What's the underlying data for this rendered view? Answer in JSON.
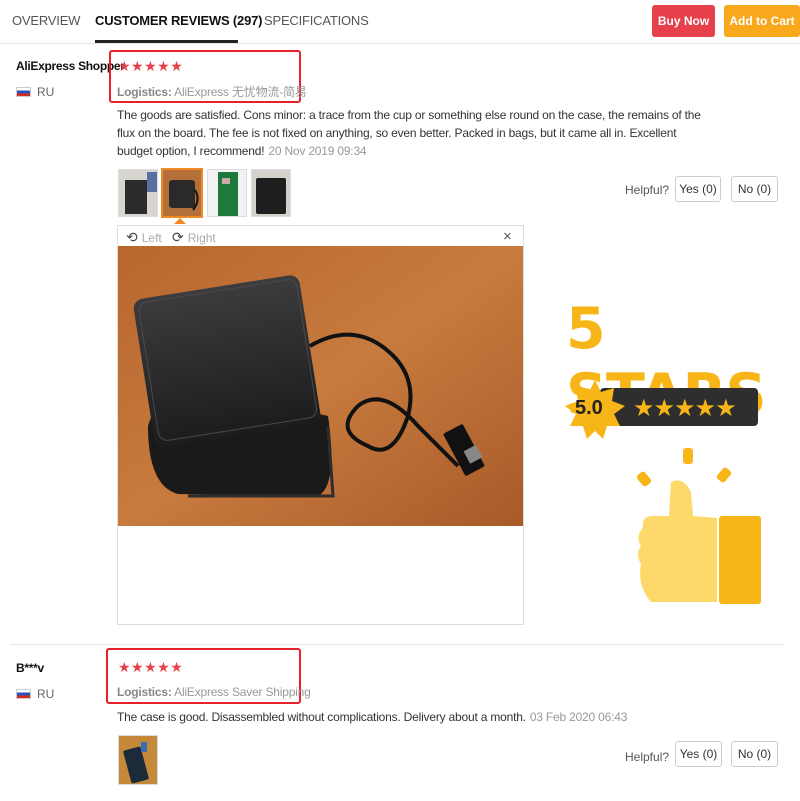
{
  "tabs": [
    {
      "label": "OVERVIEW",
      "active": false
    },
    {
      "label": "CUSTOMER REVIEWS (297)",
      "active": true
    },
    {
      "label": "SPECIFICATIONS",
      "active": false
    }
  ],
  "actions": {
    "buy_now": "Buy Now",
    "add_to_cart": "Add to Cart"
  },
  "reviews": [
    {
      "name": "AliExpress Shopper",
      "country": "RU",
      "stars": "★★★★★",
      "rating": 5,
      "logistics_label": "Logistics:",
      "logistics_value": "AliExpress 无忧物流-简易",
      "text": "The goods are satisfied. Cons minor: a trace from the cup or something else round on the case, the remains of the flux on the board. The fee is not fixed on anything, so even better. Packed in bags, but it came all in. Excellent budget option, I recommend!",
      "date": "20 Nov 2019 09:34",
      "helpful_label": "Helpful?",
      "yes_label": "Yes (0)",
      "no_label": "No (0)"
    },
    {
      "name": "B***v",
      "country": "RU",
      "stars": "★★★★★",
      "rating": 5,
      "logistics_label": "Logistics:",
      "logistics_value": "AliExpress Saver Shipping",
      "text": "The case is good. Disassembled without complications. Delivery about a month.",
      "date": "03 Feb 2020 06:43",
      "helpful_label": "Helpful?",
      "yes_label": "Yes (0)",
      "no_label": "No (0)"
    }
  ],
  "viewer": {
    "rotate_left": "Left",
    "rotate_right": "Right",
    "close": "×"
  },
  "promo": {
    "headline": "5 STARS",
    "score": "5.0",
    "stars": "★★★★★"
  },
  "colors": {
    "accent_red": "#e6404a",
    "accent_orange": "#f7a81b",
    "promo_yellow": "#f7b517"
  }
}
